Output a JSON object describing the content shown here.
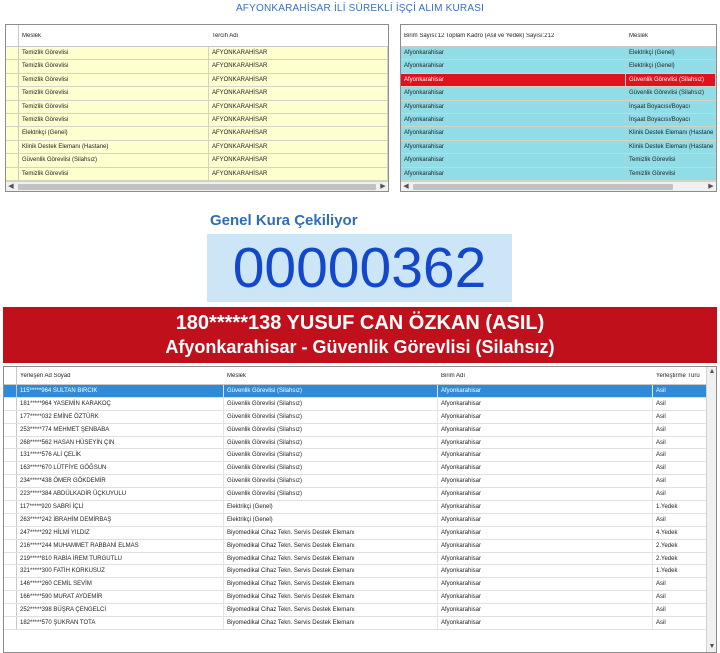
{
  "app_title": "AFYONKARAHİSAR İLİ SÜREKLİ İŞÇİ ALIM KURASI",
  "left_grid": {
    "headers": [
      "Meslek",
      "Tercih Adı"
    ],
    "rows": [
      [
        "Temizlik Görevlisi",
        "AFYONKARAHİSAR"
      ],
      [
        "Temizlik Görevlisi",
        "AFYONKARAHİSAR"
      ],
      [
        "Temizlik Görevlisi",
        "AFYONKARAHİSAR"
      ],
      [
        "Temizlik Görevlisi",
        "AFYONKARAHİSAR"
      ],
      [
        "Temizlik Görevlisi",
        "AFYONKARAHİSAR"
      ],
      [
        "Temizlik Görevlisi",
        "AFYONKARAHİSAR"
      ],
      [
        "Elektrikçi (Genel)",
        "AFYONKARAHİSAR"
      ],
      [
        "Klinik Destek Elemanı (Hastane)",
        "AFYONKARAHİSAR"
      ],
      [
        "Güvenlik Görevlisi (Silahsız)",
        "AFYONKARAHİSAR"
      ],
      [
        "Temizlik Görevlisi",
        "AFYONKARAHİSAR"
      ]
    ]
  },
  "right_grid": {
    "headers": [
      "Birim Sayısı:12 Toplam Kadro (Asil ve Yedek) Sayısı:212",
      "Meslek"
    ],
    "selected_index": 2,
    "rows": [
      [
        "Afyonkarahisar",
        "Elektrikçi (Genel)"
      ],
      [
        "Afyonkarahisar",
        "Elektrikçi (Genel)"
      ],
      [
        "Afyonkarahisar",
        "Güvenlik Görevlisi (Silahsız)"
      ],
      [
        "Afyonkarahisar",
        "Güvenlik Görevlisi (Silahsız)"
      ],
      [
        "Afyonkarahisar",
        "İnşaat Boyacısı/Boyacı"
      ],
      [
        "Afyonkarahisar",
        "İnşaat Boyacısı/Boyacı"
      ],
      [
        "Afyonkarahisar",
        "Klinik Destek Elemanı (Hastane"
      ],
      [
        "Afyonkarahisar",
        "Klinik Destek Elemanı (Hastane"
      ],
      [
        "Afyonkarahisar",
        "Temizlik Görevlisi"
      ],
      [
        "Afyonkarahisar",
        "Temizlik Görevlisi"
      ]
    ]
  },
  "draw": {
    "label": "Genel Kura Çekiliyor",
    "number": "00000362"
  },
  "winner": {
    "line1": "180*****138 YUSUF CAN ÖZKAN (ASIL)",
    "line2": "Afyonkarahisar - Güvenlik Görevlisi (Silahsız)"
  },
  "results_grid": {
    "headers": [
      "Yerleşen Ad Soyad",
      "Meslek",
      "Birim Adı",
      "Yerleştirme Türü"
    ],
    "selected_index": 0,
    "rows": [
      [
        "115*****964 SULTAN BIRCIK",
        "Güvenlik Görevlisi (Silahsız)",
        "Afyonkarahisar",
        "Asil"
      ],
      [
        "181*****964 YASEMİN KARAKOÇ",
        "Güvenlik Görevlisi (Silahsız)",
        "Afyonkarahisar",
        "Asil"
      ],
      [
        "177*****032 EMİNE ÖZTÜRK",
        "Güvenlik Görevlisi (Silahsız)",
        "Afyonkarahisar",
        "Asil"
      ],
      [
        "253*****774 MEHMET ŞENBABA",
        "Güvenlik Görevlisi (Silahsız)",
        "Afyonkarahisar",
        "Asil"
      ],
      [
        "268*****562 HASAN HÜSEYİN ÇIN",
        "Güvenlik Görevlisi (Silahsız)",
        "Afyonkarahisar",
        "Asil"
      ],
      [
        "131*****576 ALİ ÇELİK",
        "Güvenlik Görevlisi (Silahsız)",
        "Afyonkarahisar",
        "Asil"
      ],
      [
        "163*****670 LÜTFİYE GÖĞSUN",
        "Güvenlik Görevlisi (Silahsız)",
        "Afyonkarahisar",
        "Asil"
      ],
      [
        "234*****438 ÖMER GÖKDEMİR",
        "Güvenlik Görevlisi (Silahsız)",
        "Afyonkarahisar",
        "Asil"
      ],
      [
        "223*****384 ABDÜLKADİR ÜÇKUYULU",
        "Güvenlik Görevlisi (Silahsız)",
        "Afyonkarahisar",
        "Asil"
      ],
      [
        "117*****920 SABRİ İÇLİ",
        "Elektrikçi (Genel)",
        "Afyonkarahisar",
        "1.Yedek"
      ],
      [
        "263*****242 İBRAHİM DEMİRBAŞ",
        "Elektrikçi (Genel)",
        "Afyonkarahisar",
        "Asil"
      ],
      [
        "247*****292 HİLMİ YILDIZ",
        "Biyomedikal Cihaz Tekn. Servis Destek Elemanı",
        "Afyonkarahisar",
        "4.Yedek"
      ],
      [
        "216*****244 MUHAMMET RABBANİ ELMAS",
        "Biyomedikal Cihaz Tekn. Servis Destek Elemanı",
        "Afyonkarahisar",
        "2.Yedek"
      ],
      [
        "219*****810 RABİA İREM TURGUTLU",
        "Biyomedikal Cihaz Tekn. Servis Destek Elemanı",
        "Afyonkarahisar",
        "2.Yedek"
      ],
      [
        "321*****300 FATİH KORKUSUZ",
        "Biyomedikal Cihaz Tekn. Servis Destek Elemanı",
        "Afyonkarahisar",
        "1.Yedek"
      ],
      [
        "146*****260 CEMİL SEVİM",
        "Biyomedikal Cihaz Tekn. Servis Destek Elemanı",
        "Afyonkarahisar",
        "Asil"
      ],
      [
        "166*****590 MURAT AYDEMİR",
        "Biyomedikal Cihaz Tekn. Servis Destek Elemanı",
        "Afyonkarahisar",
        "Asil"
      ],
      [
        "252*****398 BÜŞRA ÇENGELCİ",
        "Biyomedikal Cihaz Tekn. Servis Destek Elemanı",
        "Afyonkarahisar",
        "Asil"
      ],
      [
        "182*****570 ŞUKRAN TOTA",
        "Biyomedikal Cihaz Tekn. Servis Destek Elemanı",
        "Afyonkarahisar",
        "Asil"
      ]
    ]
  },
  "colors": {
    "title_blue": "#3a6cc7",
    "number_blue": "#1447c9",
    "banner_red": "#c0101c",
    "selection_blue": "#2f8bd8",
    "left_grid_bg": "#ffffd0",
    "right_grid_bg": "#90dde8"
  }
}
